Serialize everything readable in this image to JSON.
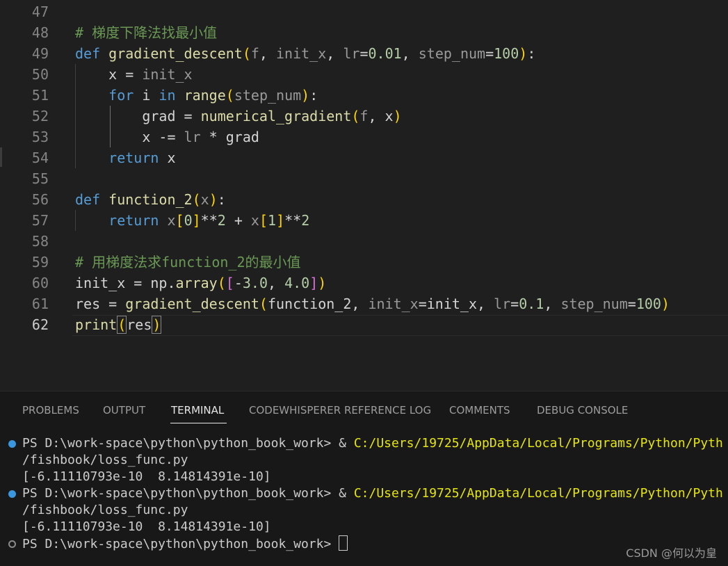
{
  "editor": {
    "lines": [
      {
        "n": "47",
        "segs": []
      },
      {
        "n": "48",
        "segs": [
          {
            "c": "cm",
            "t": "# 梯度下降法找最小值"
          }
        ]
      },
      {
        "n": "49",
        "segs": [
          {
            "c": "kw",
            "t": "def "
          },
          {
            "c": "fn",
            "t": "gradient_descent"
          },
          {
            "c": "b1",
            "t": "("
          },
          {
            "c": "pm",
            "t": "f"
          },
          {
            "c": "",
            "t": ", "
          },
          {
            "c": "pm",
            "t": "init_x"
          },
          {
            "c": "",
            "t": ", "
          },
          {
            "c": "pm",
            "t": "lr"
          },
          {
            "c": "",
            "t": "="
          },
          {
            "c": "num",
            "t": "0.01"
          },
          {
            "c": "",
            "t": ", "
          },
          {
            "c": "pm",
            "t": "step_num"
          },
          {
            "c": "",
            "t": "="
          },
          {
            "c": "num",
            "t": "100"
          },
          {
            "c": "b1",
            "t": ")"
          },
          {
            "c": "",
            "t": ":"
          }
        ]
      },
      {
        "n": "50",
        "segs": [
          {
            "c": "",
            "t": "    x = "
          },
          {
            "c": "pm",
            "t": "init_x"
          }
        ]
      },
      {
        "n": "51",
        "segs": [
          {
            "c": "",
            "t": "    "
          },
          {
            "c": "kw",
            "t": "for"
          },
          {
            "c": "",
            "t": " i "
          },
          {
            "c": "kw",
            "t": "in"
          },
          {
            "c": "",
            "t": " "
          },
          {
            "c": "fn",
            "t": "range"
          },
          {
            "c": "b1",
            "t": "("
          },
          {
            "c": "pm",
            "t": "step_num"
          },
          {
            "c": "b1",
            "t": ")"
          },
          {
            "c": "",
            "t": ":"
          }
        ]
      },
      {
        "n": "52",
        "segs": [
          {
            "c": "",
            "t": "        grad = "
          },
          {
            "c": "fn",
            "t": "numerical_gradient"
          },
          {
            "c": "b1",
            "t": "("
          },
          {
            "c": "pm",
            "t": "f"
          },
          {
            "c": "",
            "t": ", x"
          },
          {
            "c": "b1",
            "t": ")"
          }
        ]
      },
      {
        "n": "53",
        "segs": [
          {
            "c": "",
            "t": "        x -= "
          },
          {
            "c": "pm",
            "t": "lr"
          },
          {
            "c": "",
            "t": " * grad"
          }
        ]
      },
      {
        "n": "54",
        "segs": [
          {
            "c": "",
            "t": "    "
          },
          {
            "c": "kw",
            "t": "return"
          },
          {
            "c": "",
            "t": " x"
          }
        ]
      },
      {
        "n": "55",
        "segs": []
      },
      {
        "n": "56",
        "segs": [
          {
            "c": "kw",
            "t": "def "
          },
          {
            "c": "fn",
            "t": "function_2"
          },
          {
            "c": "b1",
            "t": "("
          },
          {
            "c": "pm",
            "t": "x"
          },
          {
            "c": "b1",
            "t": ")"
          },
          {
            "c": "",
            "t": ":"
          }
        ]
      },
      {
        "n": "57",
        "segs": [
          {
            "c": "",
            "t": "    "
          },
          {
            "c": "kw",
            "t": "return"
          },
          {
            "c": "",
            "t": " "
          },
          {
            "c": "pm",
            "t": "x"
          },
          {
            "c": "b1",
            "t": "["
          },
          {
            "c": "num",
            "t": "0"
          },
          {
            "c": "b1",
            "t": "]"
          },
          {
            "c": "",
            "t": "**"
          },
          {
            "c": "num",
            "t": "2"
          },
          {
            "c": "",
            "t": " + "
          },
          {
            "c": "pm",
            "t": "x"
          },
          {
            "c": "b1",
            "t": "["
          },
          {
            "c": "num",
            "t": "1"
          },
          {
            "c": "b1",
            "t": "]"
          },
          {
            "c": "",
            "t": "**"
          },
          {
            "c": "num",
            "t": "2"
          }
        ]
      },
      {
        "n": "58",
        "segs": []
      },
      {
        "n": "59",
        "segs": [
          {
            "c": "cm",
            "t": "# 用梯度法求function_2的最小值"
          }
        ]
      },
      {
        "n": "60",
        "segs": [
          {
            "c": "",
            "t": "init_x = np."
          },
          {
            "c": "fn",
            "t": "array"
          },
          {
            "c": "b1",
            "t": "("
          },
          {
            "c": "b2",
            "t": "["
          },
          {
            "c": "",
            "t": "-"
          },
          {
            "c": "num",
            "t": "3.0"
          },
          {
            "c": "",
            "t": ", "
          },
          {
            "c": "num",
            "t": "4.0"
          },
          {
            "c": "b2",
            "t": "]"
          },
          {
            "c": "b1",
            "t": ")"
          }
        ]
      },
      {
        "n": "61",
        "segs": [
          {
            "c": "",
            "t": "res = "
          },
          {
            "c": "fn",
            "t": "gradient_descent"
          },
          {
            "c": "b1",
            "t": "("
          },
          {
            "c": "",
            "t": "function_2, "
          },
          {
            "c": "pm",
            "t": "init_x"
          },
          {
            "c": "",
            "t": "=init_x, "
          },
          {
            "c": "pm",
            "t": "lr"
          },
          {
            "c": "",
            "t": "="
          },
          {
            "c": "num",
            "t": "0.1"
          },
          {
            "c": "",
            "t": ", "
          },
          {
            "c": "pm",
            "t": "step_num"
          },
          {
            "c": "",
            "t": "="
          },
          {
            "c": "num",
            "t": "100"
          },
          {
            "c": "b1",
            "t": ")"
          }
        ]
      },
      {
        "n": "62",
        "segs": [
          {
            "c": "fn",
            "t": "print"
          },
          {
            "c": "b1 caret-box",
            "t": "("
          },
          {
            "c": "",
            "t": "res"
          },
          {
            "c": "b1 caret-box",
            "t": ")"
          }
        ]
      }
    ]
  },
  "panel": {
    "tabs": [
      "PROBLEMS",
      "OUTPUT",
      "TERMINAL",
      "CODEWHISPERER REFERENCE LOG",
      "COMMENTS",
      "DEBUG CONSOLE"
    ],
    "active_tab": "TERMINAL",
    "terminal": [
      {
        "dot": "filled",
        "prompt": "PS D:\\work-space\\python\\python_book_work> & ",
        "path": "C:/Users/19725/AppData/Local/Programs/Python/Pyth"
      },
      {
        "dot": "",
        "prompt": "/fishbook/loss_func.py",
        "path": ""
      },
      {
        "dot": "",
        "prompt": "[-6.11110793e-10  8.14814391e-10]",
        "path": ""
      },
      {
        "dot": "filled",
        "prompt": "PS D:\\work-space\\python\\python_book_work> & ",
        "path": "C:/Users/19725/AppData/Local/Programs/Python/Pyth"
      },
      {
        "dot": "",
        "prompt": "/fishbook/loss_func.py",
        "path": ""
      },
      {
        "dot": "",
        "prompt": "[-6.11110793e-10  8.14814391e-10]",
        "path": ""
      },
      {
        "dot": "hollow",
        "prompt": "PS D:\\work-space\\python\\python_book_work> ",
        "path": ""
      }
    ]
  },
  "watermark": "CSDN @何以为皇"
}
